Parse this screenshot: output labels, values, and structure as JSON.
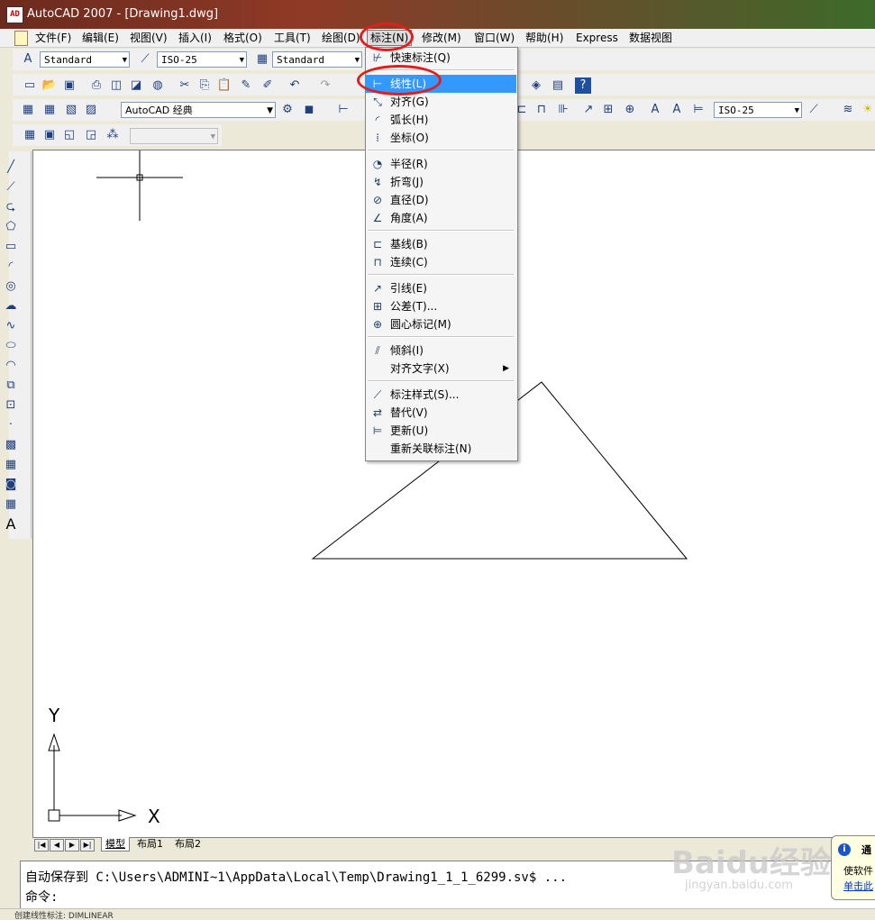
{
  "window": {
    "title": "AutoCAD 2007 - [Drawing1.dwg]",
    "app_icon_text": "AD"
  },
  "menubar": {
    "items": [
      "文件(F)",
      "编辑(E)",
      "视图(V)",
      "插入(I)",
      "格式(O)",
      "工具(T)",
      "绘图(D)",
      "标注(N)",
      "修改(M)",
      "窗口(W)",
      "帮助(H)",
      "Express",
      "数据视图"
    ],
    "active": "标注(N)"
  },
  "toolbar1": {
    "text_style": "Standard",
    "dim_style": "ISO-25",
    "table_style": "Standard"
  },
  "toolbar3": {
    "workspace": "AutoCAD 经典",
    "dim_style_right": "ISO-25"
  },
  "dim_menu": {
    "items": [
      {
        "label": "快速标注(Q)",
        "icon": "quick-dim-icon"
      },
      {
        "label": "线性(L)",
        "icon": "linear-dim-icon",
        "highlighted": true
      },
      {
        "label": "对齐(G)",
        "icon": "aligned-dim-icon"
      },
      {
        "label": "弧长(H)",
        "icon": "arc-length-icon"
      },
      {
        "label": "坐标(O)",
        "icon": "ordinate-icon"
      },
      {
        "label": "半径(R)",
        "icon": "radius-icon"
      },
      {
        "label": "折弯(J)",
        "icon": "jogged-icon"
      },
      {
        "label": "直径(D)",
        "icon": "diameter-icon"
      },
      {
        "label": "角度(A)",
        "icon": "angular-icon"
      },
      {
        "label": "基线(B)",
        "icon": "baseline-icon"
      },
      {
        "label": "连续(C)",
        "icon": "continue-icon"
      },
      {
        "label": "引线(E)",
        "icon": "leader-icon"
      },
      {
        "label": "公差(T)...",
        "icon": "tolerance-icon"
      },
      {
        "label": "圆心标记(M)",
        "icon": "center-mark-icon"
      },
      {
        "label": "倾斜(I)",
        "icon": "oblique-icon"
      },
      {
        "label": "对齐文字(X)",
        "icon": "",
        "submenu": true
      },
      {
        "label": "标注样式(S)...",
        "icon": "dim-style-icon"
      },
      {
        "label": "替代(V)",
        "icon": "override-icon"
      },
      {
        "label": "更新(U)",
        "icon": "update-icon"
      },
      {
        "label": "重新关联标注(N)",
        "icon": ""
      }
    ]
  },
  "ucs": {
    "x_label": "X",
    "y_label": "Y"
  },
  "layout_tabs": [
    "模型",
    "布局1",
    "布局2"
  ],
  "command": {
    "line1": "自动保存到 C:\\Users\\ADMINI~1\\AppData\\Local\\Temp\\Drawing1_1_1_6299.sv$ ...",
    "line2": "命令:"
  },
  "status": {
    "text": "创建线性标注: DIMLINEAR"
  },
  "notification": {
    "title": "通",
    "body": "使软件",
    "link": "单击此"
  },
  "watermark": {
    "main": "Baidu经验",
    "sub": "jingyan.baidu.com"
  },
  "colors": {
    "highlight": "#3399ff",
    "annotation": "#e01e1e"
  }
}
